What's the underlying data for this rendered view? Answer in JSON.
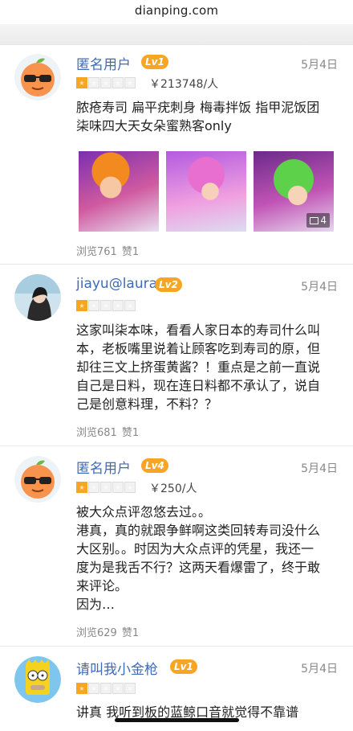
{
  "browser": {
    "url": "dianping.com"
  },
  "reviews": [
    {
      "username": "匿名用户",
      "level": "Lv1",
      "date": "5月4日",
      "rating": 1,
      "price": "￥213748/人",
      "text": [
        "脓疮寿司 扁平疣刺身 梅毒拌饭 指甲泥饭团",
        "柒味四大天女朵蜜熟客only"
      ],
      "photo_count": "4",
      "views": "浏览761",
      "likes": "赞1"
    },
    {
      "username": "jiayu@laura",
      "level": "Lv2",
      "date": "5月4日",
      "rating": 1,
      "text": [
        "这家叫柒本味，看看人家日本的寿司什么叫",
        "本，老板嘴里说着让顾客吃到寿司的原，但",
        "却往三文上挤蛋黄酱？！重点是之前一直说",
        "自己是日料，现在连日料都不承认了，说自",
        "己是创意料理，不料？？"
      ],
      "views": "浏览681",
      "likes": "赞1"
    },
    {
      "username": "匿名用户",
      "level": "Lv4",
      "date": "5月4日",
      "rating": 1,
      "price": "￥250/人",
      "text": [
        "被大众点评忽悠去过。。",
        "港真，真的就跟争鲜啊这类回转寿司没什么",
        "大区别。。时因为大众点评的凭星，我还一",
        "度为是我舌不行？这两天看爆雷了，终于敢",
        "来评论。",
        "因为…"
      ],
      "views": "浏览629",
      "likes": "赞1"
    },
    {
      "username": "请叫我小金枪",
      "level": "Lv1",
      "date": "5月4日",
      "rating": 1,
      "text": [
        "讲真 我听到板的蓝鲸口音就觉得不靠谱"
      ]
    }
  ],
  "colors": {
    "username": "#3d6bb7",
    "level_badge": "#f6a623",
    "star_on": "#f6a623"
  }
}
